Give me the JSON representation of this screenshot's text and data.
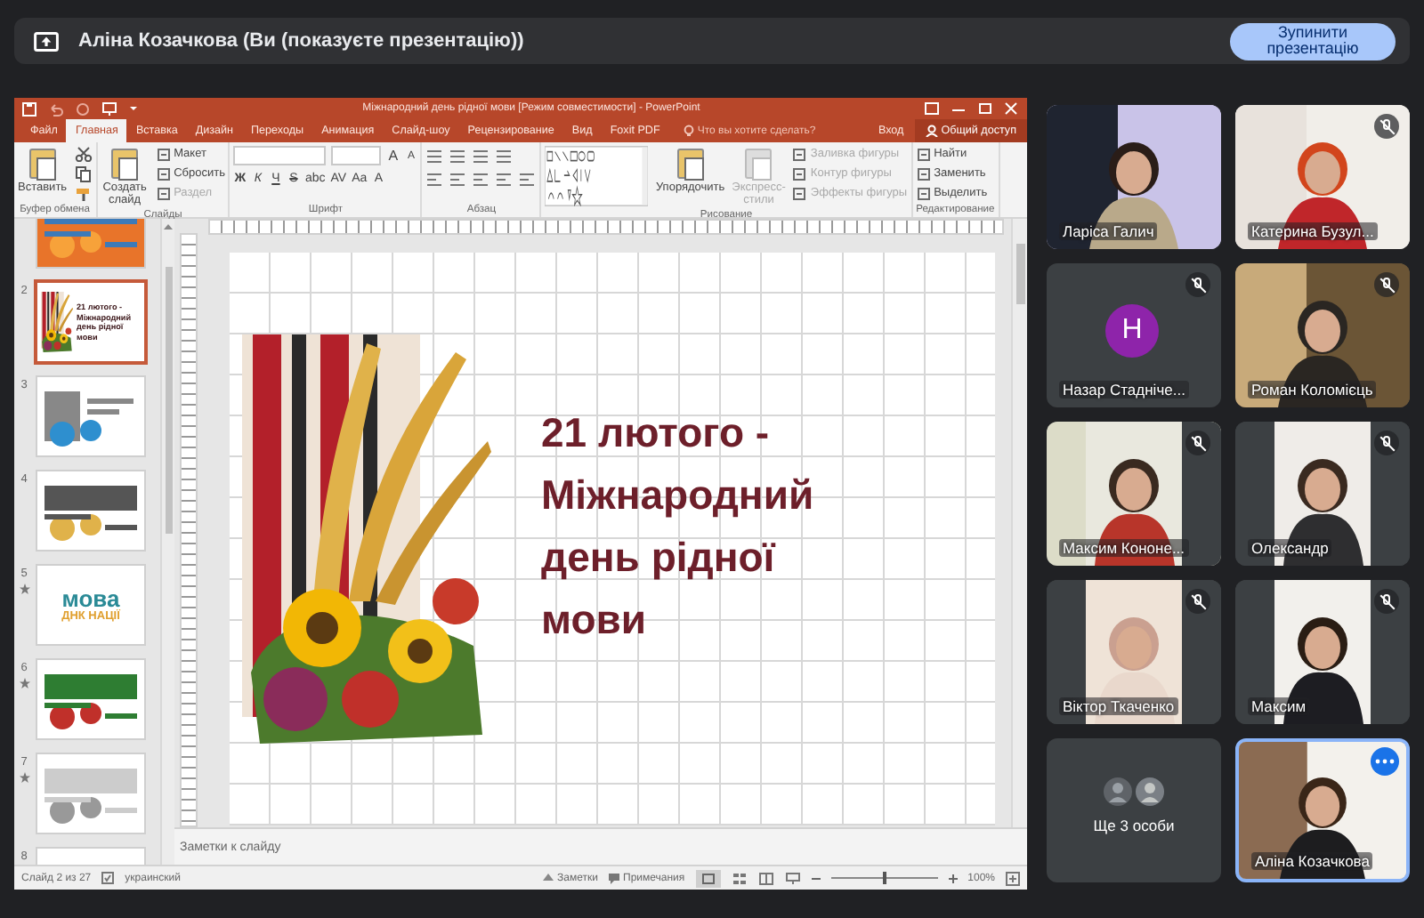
{
  "presentation_bar": {
    "presenter_label": "Аліна Козачкова (Ви (показуєте презентацію))",
    "stop_button": "Зупинити презентацію"
  },
  "powerpoint": {
    "title": "Міжнародний день рідної мови [Режим совместимости] - PowerPoint",
    "tabs": [
      {
        "label": "Файл",
        "selected": false
      },
      {
        "label": "Главная",
        "selected": true
      },
      {
        "label": "Вставка",
        "selected": false
      },
      {
        "label": "Дизайн",
        "selected": false
      },
      {
        "label": "Переходы",
        "selected": false
      },
      {
        "label": "Анимация",
        "selected": false
      },
      {
        "label": "Слайд-шоу",
        "selected": false
      },
      {
        "label": "Рецензирование",
        "selected": false
      },
      {
        "label": "Вид",
        "selected": false
      },
      {
        "label": "Foxit PDF",
        "selected": false
      }
    ],
    "tell_me": {
      "placeholder": "Что вы хотите сделать?"
    },
    "sign_in": "Вход",
    "share": "Общий доступ",
    "ribbon_groups": [
      {
        "label": "Буфер обмена",
        "items": [
          {
            "kind": "large",
            "label": "Вставить",
            "disabled": false
          },
          {
            "kind": "tools"
          }
        ]
      },
      {
        "label": "Слайды",
        "items": [
          {
            "kind": "large",
            "label": "Создать слайд",
            "disabled": false
          },
          {
            "kind": "stack",
            "buttons": [
              {
                "label": "Макет",
                "disabled": false
              },
              {
                "label": "Сбросить",
                "disabled": false
              },
              {
                "label": "Раздел",
                "disabled": true
              }
            ]
          }
        ]
      },
      {
        "label": "Шрифт",
        "items": [
          {
            "kind": "font",
            "size_buttons": [
              "A",
              "A"
            ],
            "format_buttons": [
              "Ж",
              "К",
              "Ч",
              "S",
              "abc",
              "AV",
              "Aa",
              "A"
            ]
          }
        ]
      },
      {
        "label": "Абзац",
        "items": [
          {
            "kind": "paragraph"
          }
        ]
      },
      {
        "label": "Рисование",
        "items": [
          {
            "kind": "shapes"
          },
          {
            "kind": "large",
            "label": "Упорядочить",
            "disabled": false
          },
          {
            "kind": "large",
            "label": "Экспресс-стили",
            "disabled": true
          },
          {
            "kind": "stack",
            "buttons": [
              {
                "label": "Заливка фигуры",
                "disabled": true
              },
              {
                "label": "Контур фигуры",
                "disabled": true
              },
              {
                "label": "Эффекты фигуры",
                "disabled": true
              }
            ]
          }
        ]
      },
      {
        "label": "Редактирование",
        "items": [
          {
            "kind": "stack",
            "buttons": [
              {
                "label": "Найти",
                "disabled": false
              },
              {
                "label": "Заменить",
                "disabled": false
              },
              {
                "label": "Выделить",
                "disabled": false
              }
            ]
          }
        ]
      }
    ],
    "thumbnails": [
      {
        "kind": "picture",
        "selected": false,
        "animated": false
      },
      {
        "number": "2",
        "kind": "title",
        "texts": [
          "21 лютого - Міжнародний день рідної мови"
        ],
        "selected": true,
        "animated": false
      },
      {
        "number": "3",
        "kind": "picture",
        "selected": false,
        "animated": false
      },
      {
        "number": "4",
        "kind": "picture",
        "selected": false,
        "animated": false
      },
      {
        "number": "5",
        "kind": "wordmark",
        "texts": [
          "мова",
          "ДНК НАЦІЇ"
        ],
        "selected": false,
        "animated": true
      },
      {
        "number": "6",
        "kind": "picture",
        "selected": false,
        "animated": true
      },
      {
        "number": "7",
        "kind": "picture",
        "selected": false,
        "animated": true
      },
      {
        "number": "8",
        "selected": false
      }
    ],
    "slide": {
      "title_lines": [
        "21 лютого -",
        "Міжнародний",
        "день рідної",
        "мови"
      ]
    },
    "notes": {
      "placeholder": "Заметки к слайду"
    },
    "status_bar": {
      "slide_counter": "Слайд 2 из 27",
      "language": "украинский",
      "notes_button": "Заметки",
      "comments_button": "Примечания",
      "zoom": {
        "level": 0.5
      },
      "zoom_reading": "100%"
    }
  },
  "participants": [
    {
      "kind": "video",
      "name": "Ларіса Галич",
      "muted": false,
      "selected": false
    },
    {
      "kind": "video",
      "name": "Катерина Бузул...",
      "muted": true,
      "selected": false
    },
    {
      "kind": "avatar",
      "name": "Назар Стадніче...",
      "initial": "Н",
      "muted": true,
      "selected": false
    },
    {
      "kind": "video",
      "name": "Роман Коломієць",
      "muted": true,
      "selected": false
    },
    {
      "kind": "video",
      "name": "Максим Кононе...",
      "muted": true,
      "selected": false
    },
    {
      "kind": "video",
      "name": "Олександр",
      "muted": true,
      "selected": false
    },
    {
      "kind": "video",
      "name": "Віктор Ткаченко",
      "muted": true,
      "selected": false
    },
    {
      "kind": "video",
      "name": "Максим",
      "muted": true,
      "selected": false
    },
    {
      "kind": "more",
      "name": "Ще 3 особи",
      "selected": false
    },
    {
      "kind": "video",
      "name": "Аліна Козачкова",
      "muted": false,
      "selected": true
    }
  ]
}
